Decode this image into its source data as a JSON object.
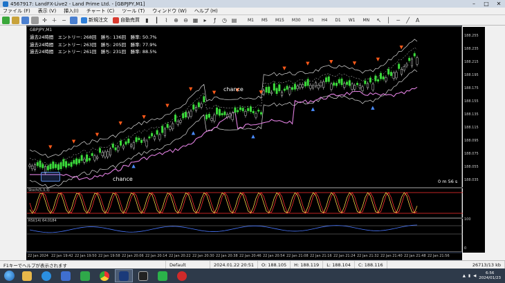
{
  "window": {
    "title": "4567917: LandFX-Live2 - Land Prime Ltd. - [GBPJPY,M1]"
  },
  "menu": [
    "ファイル (F)",
    "表示 (V)",
    "挿入(I)",
    "チャート (C)",
    "ツール (T)",
    "ウィンドウ (W)",
    "ヘルプ (H)"
  ],
  "toolbar": {
    "new_order": "新規注文",
    "auto_trade": "自動売買",
    "timeframes": [
      "M1",
      "M5",
      "M15",
      "M30",
      "H1",
      "H4",
      "D1",
      "W1",
      "MN"
    ]
  },
  "chart": {
    "symbol_header": "GBPJPY,M1",
    "stats": [
      "過去24時間　エントリー: 268回　勝ち: 136回　勝率: 50.7%",
      "過去24時間　エントリー: 263回　勝ち: 205回　勝率: 77.9%",
      "過去24時間　エントリー: 261回　勝ち: 231回　勝率: 88.5%"
    ],
    "annotations": {
      "chance1": "chance",
      "chance2": "chance",
      "timer": "0 m 56 s"
    },
    "stoch_label": "Stoch(5,3,3)",
    "rsi_label": "RSI(14) 64.0184",
    "rsi_ticks": [
      "100",
      "0"
    ],
    "y_ticks": [
      "188.255",
      "188.235",
      "188.215",
      "188.195",
      "188.175",
      "188.155",
      "188.135",
      "188.115",
      "188.095",
      "188.075",
      "188.055",
      "188.035"
    ],
    "x_ticks": [
      "22 Jan 2024",
      "22 Jan 19:42",
      "22 Jan 19:50",
      "22 Jan 19:58",
      "22 Jan 20:06",
      "22 Jan 20:14",
      "22 Jan 20:22",
      "22 Jan 20:30",
      "22 Jan 20:38",
      "22 Jan 20:46",
      "22 Jan 20:54",
      "22 Jan 21:08",
      "22 Jan 21:16",
      "22 Jan 21:24",
      "22 Jan 21:32",
      "22 Jan 21:40",
      "22 Jan 21:48",
      "22 Jan 21:56"
    ]
  },
  "status": {
    "left": "F1キーでヘルプが表示されます",
    "profile": "Default",
    "datetime": "2024.01.22 20:51",
    "open": "O: 188.105",
    "high": "H: 188.119",
    "low": "L: 188.104",
    "close": "C: 188.116",
    "traffic": "26713/13 kb"
  },
  "tray": {
    "time": "6:56",
    "date": "2024/01/23"
  },
  "colors": {
    "bull": "#3cdc3c",
    "bear": "#ffffff",
    "band": "#dddddd",
    "ma": "#e080e0",
    "stoch_hi": "#ff3030",
    "stoch_lo": "#ffd24a",
    "rsi": "#4a78ff",
    "sell_arrow": "#ff5a1a",
    "buy_arrow": "#4a8cff"
  }
}
